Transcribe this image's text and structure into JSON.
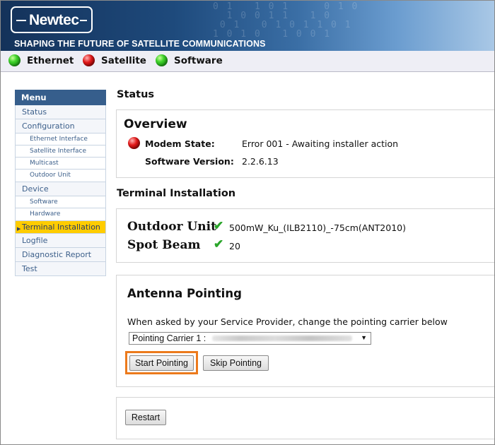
{
  "header": {
    "logo_text": "Newtec",
    "tagline": "SHAPING THE FUTURE OF SATELLITE COMMUNICATIONS"
  },
  "indicators": [
    {
      "label": "Ethernet",
      "state": "green"
    },
    {
      "label": "Satellite",
      "state": "red"
    },
    {
      "label": "Software",
      "state": "green"
    }
  ],
  "menu": {
    "title": "Menu",
    "items": [
      {
        "label": "Status",
        "level": 0
      },
      {
        "label": "Configuration",
        "level": 0
      },
      {
        "label": "Ethernet Interface",
        "level": 1
      },
      {
        "label": "Satellite Interface",
        "level": 1
      },
      {
        "label": "Multicast",
        "level": 1
      },
      {
        "label": "Outdoor Unit",
        "level": 1
      },
      {
        "label": "Device",
        "level": 0
      },
      {
        "label": "Software",
        "level": 1
      },
      {
        "label": "Hardware",
        "level": 1
      },
      {
        "label": "Terminal Installation",
        "level": 0,
        "active": true
      },
      {
        "label": "Logfile",
        "level": 0
      },
      {
        "label": "Diagnostic Report",
        "level": 0
      },
      {
        "label": "Test",
        "level": 0
      }
    ]
  },
  "main": {
    "heading": "Status",
    "overview": {
      "title": "Overview",
      "modem_state_label": "Modem State:",
      "modem_state_value": "Error 001 - Awaiting installer action",
      "software_version_label": "Software Version:",
      "software_version_value": "2.2.6.13"
    },
    "terminal_heading": "Terminal Installation",
    "terminal": {
      "outdoor_unit_label": "Outdoor Unit",
      "outdoor_unit_value": "500mW_Ku_(ILB2110)_-75cm(ANT2010)",
      "spot_beam_label": "Spot Beam",
      "spot_beam_value": "20"
    },
    "antenna": {
      "title": "Antenna Pointing",
      "description": "When asked by your Service Provider, change the pointing carrier below",
      "carrier_select_value": "Pointing Carrier 1 :",
      "start_button": "Start Pointing",
      "skip_button": "Skip Pointing"
    },
    "restart_button": "Restart"
  },
  "colors": {
    "menu_header": "#365e8c",
    "menu_active": "#ffcc00",
    "highlight": "#ec7a1c",
    "led_green": "#3fd22b",
    "led_red": "#e21818"
  }
}
